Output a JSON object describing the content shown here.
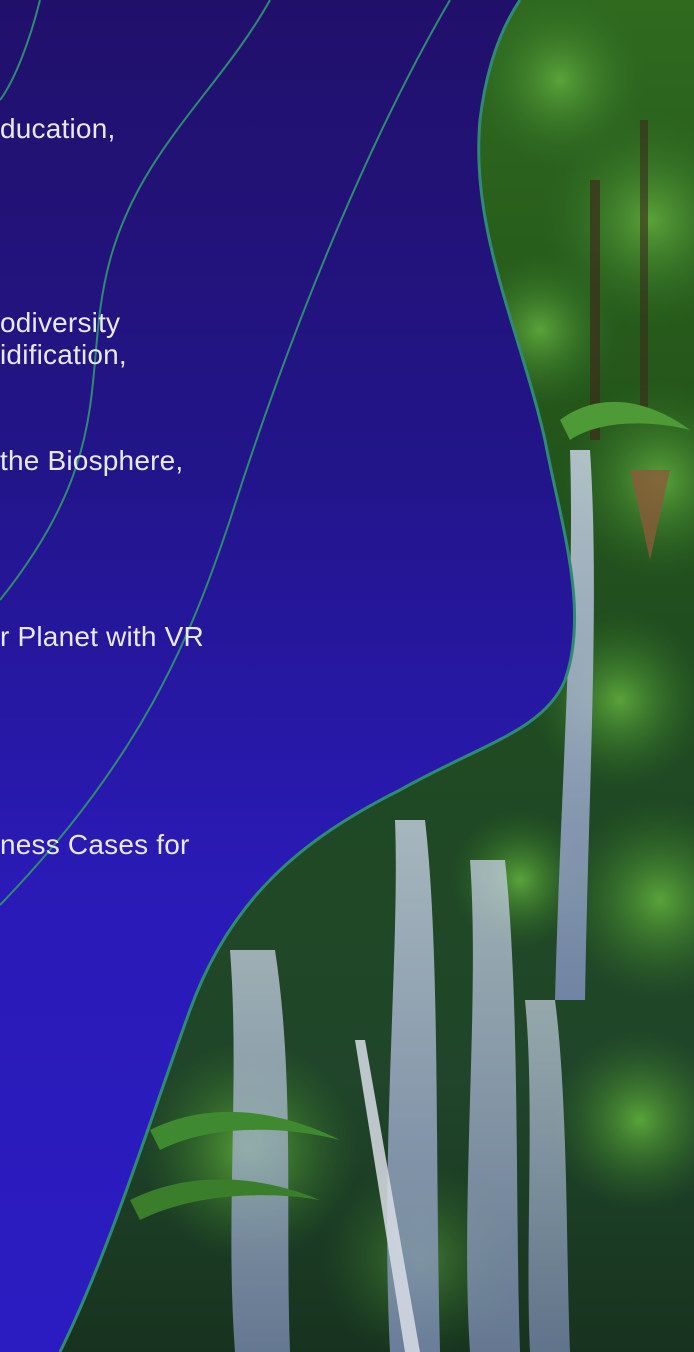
{
  "slide": {
    "lines": [
      "ducation,",
      "odiversity",
      "idification,",
      "the Biosphere,",
      "r Planet with VR",
      "ness Cases for"
    ]
  },
  "colors": {
    "background_top": "#21106a",
    "background_bottom": "#2b1cc2",
    "accent_line": "#2f8a74",
    "text": "#e9e8f6"
  },
  "image": {
    "subject": "rainforest waterfall photo inside wavy blob shape"
  }
}
